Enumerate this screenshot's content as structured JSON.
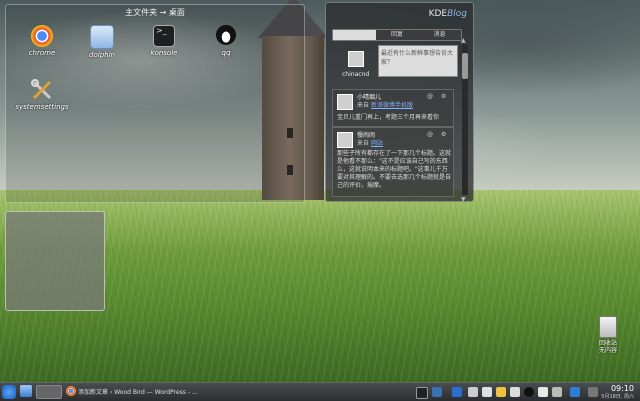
{
  "desktop": {
    "folder_view_title": "主文件夹 → 桌面",
    "icons": [
      {
        "label": "chrome",
        "icon": "chrome-icon",
        "color": "#d84a38"
      },
      {
        "label": "dolphin",
        "icon": "dolphin-icon",
        "color": "#8fb7e6"
      },
      {
        "label": "konsole",
        "icon": "terminal-icon",
        "color": "#222222"
      },
      {
        "label": "qq",
        "icon": "qq-penguin-icon",
        "color": "#111111"
      },
      {
        "label": "systemsettings",
        "icon": "wrench-screwdriver-icon",
        "color": "#e0a030"
      }
    ],
    "trash_label": "回收站",
    "trash_sub": "无内容"
  },
  "microblog": {
    "brand_prefix": "KDE",
    "brand_suffix": "Blog",
    "tabs": [
      "",
      "回复",
      "消息"
    ],
    "compose_user": "chinacnd",
    "compose_placeholder": "最近有什么新鲜事想告诉大家？",
    "posts": [
      {
        "name": "小晴烟儿",
        "source_prefix": "来自",
        "source_link": "新浪微博手机版",
        "body": "宝贝儿重门再上，考题三个月再来看你"
      },
      {
        "name": "慢闹闹",
        "source_prefix": "来自",
        "source_link": "网站",
        "body": "那些子所有都存在了一下那几个标题。这就是他看不那么：\"这不是应该自己写的东西么，这就说明本来的标题吧。\"这事儿千万要对其理解的。不要去选那几个标题就是自己的评价。揣摩。"
      }
    ]
  },
  "taskbar": {
    "tasks": [
      "添加新文章 ‹ Wood Bird — WordPress - ..."
    ],
    "clock_time": "09:10",
    "clock_date": "5月18日, 周六"
  }
}
